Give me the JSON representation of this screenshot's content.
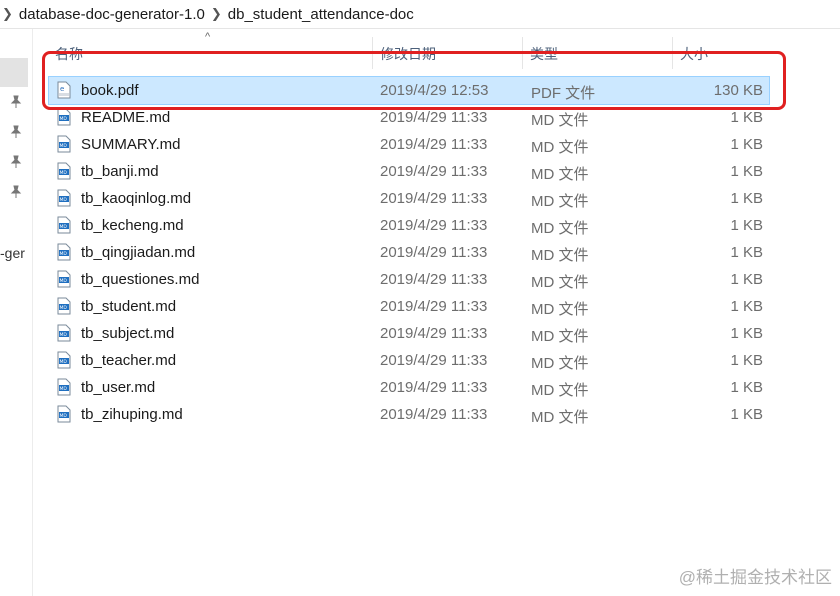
{
  "breadcrumb": {
    "items": [
      "database-doc-generator-1.0",
      "db_student_attendance-doc"
    ]
  },
  "nav": {
    "partial_label": "-ger"
  },
  "columns": {
    "name": "名称",
    "date": "修改日期",
    "type": "类型",
    "size": "大小"
  },
  "files": [
    {
      "name": "book.pdf",
      "date": "2019/4/29 12:53",
      "type": "PDF 文件",
      "size": "130 KB",
      "icon": "pdf-file-icon",
      "selected": true
    },
    {
      "name": "README.md",
      "date": "2019/4/29 11:33",
      "type": "MD 文件",
      "size": "1 KB",
      "icon": "md-file-icon"
    },
    {
      "name": "SUMMARY.md",
      "date": "2019/4/29 11:33",
      "type": "MD 文件",
      "size": "1 KB",
      "icon": "md-file-icon"
    },
    {
      "name": "tb_banji.md",
      "date": "2019/4/29 11:33",
      "type": "MD 文件",
      "size": "1 KB",
      "icon": "md-file-icon"
    },
    {
      "name": "tb_kaoqinlog.md",
      "date": "2019/4/29 11:33",
      "type": "MD 文件",
      "size": "1 KB",
      "icon": "md-file-icon"
    },
    {
      "name": "tb_kecheng.md",
      "date": "2019/4/29 11:33",
      "type": "MD 文件",
      "size": "1 KB",
      "icon": "md-file-icon"
    },
    {
      "name": "tb_qingjiadan.md",
      "date": "2019/4/29 11:33",
      "type": "MD 文件",
      "size": "1 KB",
      "icon": "md-file-icon"
    },
    {
      "name": "tb_questiones.md",
      "date": "2019/4/29 11:33",
      "type": "MD 文件",
      "size": "1 KB",
      "icon": "md-file-icon"
    },
    {
      "name": "tb_student.md",
      "date": "2019/4/29 11:33",
      "type": "MD 文件",
      "size": "1 KB",
      "icon": "md-file-icon"
    },
    {
      "name": "tb_subject.md",
      "date": "2019/4/29 11:33",
      "type": "MD 文件",
      "size": "1 KB",
      "icon": "md-file-icon"
    },
    {
      "name": "tb_teacher.md",
      "date": "2019/4/29 11:33",
      "type": "MD 文件",
      "size": "1 KB",
      "icon": "md-file-icon"
    },
    {
      "name": "tb_user.md",
      "date": "2019/4/29 11:33",
      "type": "MD 文件",
      "size": "1 KB",
      "icon": "md-file-icon"
    },
    {
      "name": "tb_zihuping.md",
      "date": "2019/4/29 11:33",
      "type": "MD 文件",
      "size": "1 KB",
      "icon": "md-file-icon"
    }
  ],
  "watermark": "@稀土掘金技术社区",
  "colors": {
    "selection": "#cce8ff",
    "annotation": "#e02020"
  }
}
